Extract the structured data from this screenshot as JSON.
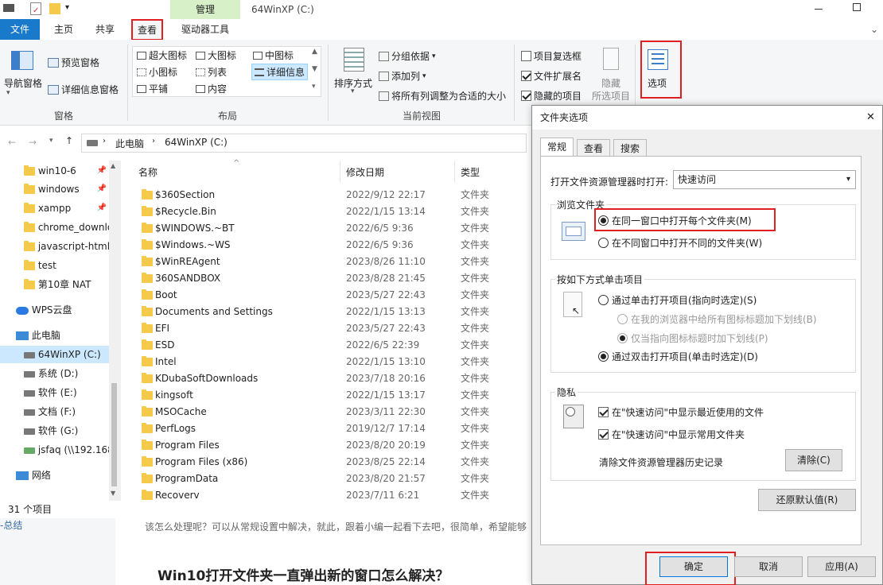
{
  "titlebar": {
    "manage_tab": "管理",
    "title": "64WinXP  (C:)"
  },
  "ribbon_tabs": {
    "file": "文件",
    "home": "主页",
    "share": "共享",
    "view": "查看",
    "drive_tools": "驱动器工具"
  },
  "ribbon": {
    "pane": {
      "nav_pane": "导航窗格",
      "preview_pane": "预览窗格",
      "details_pane": "详细信息窗格",
      "label": "窗格"
    },
    "layout": {
      "xl_icons": "超大图标",
      "large_icons": "大图标",
      "medium_icons": "中图标",
      "small_icons": "小图标",
      "list": "列表",
      "details": "详细信息",
      "tiles": "平铺",
      "content": "内容",
      "label": "布局"
    },
    "current_view": {
      "sort_by": "排序方式",
      "group_by": "分组依据",
      "add_columns": "添加列",
      "fit_columns": "将所有列调整为合适的大小",
      "label": "当前视图"
    },
    "show_hide": {
      "item_checkboxes": "项目复选框",
      "file_ext": "文件扩展名",
      "hidden_items": "隐藏的项目",
      "hide": "隐藏",
      "hide_sub": "所选项目",
      "item_checkboxes_checked": false,
      "file_ext_checked": true,
      "hidden_items_checked": true
    },
    "options": "选项"
  },
  "address": {
    "this_pc": "此电脑",
    "drive": "64WinXP  (C:)"
  },
  "nav": {
    "quick": [
      {
        "label": "win10-6"
      },
      {
        "label": "windows"
      },
      {
        "label": "xampp"
      },
      {
        "label": "chrome_downlo"
      },
      {
        "label": "javascript-html"
      },
      {
        "label": "test"
      },
      {
        "label": "第10章 NAT"
      }
    ],
    "wps": "WPS云盘",
    "this_pc": "此电脑",
    "drives": [
      {
        "label": "64WinXP  (C:)"
      },
      {
        "label": "系统 (D:)"
      },
      {
        "label": "软件 (E:)"
      },
      {
        "label": "文档 (F:)"
      },
      {
        "label": "软件 (G:)"
      },
      {
        "label": "jsfaq (\\\\192.168"
      }
    ],
    "network": "网络"
  },
  "columns": {
    "name": "名称",
    "date": "修改日期",
    "type": "类型"
  },
  "files": [
    {
      "name": "$360Section",
      "date": "2022/9/12 22:17",
      "type": "文件夹"
    },
    {
      "name": "$Recycle.Bin",
      "date": "2022/1/15 13:14",
      "type": "文件夹"
    },
    {
      "name": "$WINDOWS.~BT",
      "date": "2022/6/5 9:36",
      "type": "文件夹"
    },
    {
      "name": "$Windows.~WS",
      "date": "2022/6/5 9:36",
      "type": "文件夹"
    },
    {
      "name": "$WinREAgent",
      "date": "2023/8/26 11:10",
      "type": "文件夹"
    },
    {
      "name": "360SANDBOX",
      "date": "2023/8/28 21:45",
      "type": "文件夹"
    },
    {
      "name": "Boot",
      "date": "2023/5/27 22:43",
      "type": "文件夹"
    },
    {
      "name": "Documents and Settings",
      "date": "2022/1/15 13:13",
      "type": "文件夹"
    },
    {
      "name": "EFI",
      "date": "2023/5/27 22:43",
      "type": "文件夹"
    },
    {
      "name": "ESD",
      "date": "2022/6/5 22:39",
      "type": "文件夹"
    },
    {
      "name": "Intel",
      "date": "2022/1/15 13:10",
      "type": "文件夹"
    },
    {
      "name": "KDubaSoftDownloads",
      "date": "2023/7/18 20:16",
      "type": "文件夹"
    },
    {
      "name": "kingsoft",
      "date": "2022/1/15 13:17",
      "type": "文件夹"
    },
    {
      "name": "MSOCache",
      "date": "2023/3/11 22:30",
      "type": "文件夹"
    },
    {
      "name": "PerfLogs",
      "date": "2019/12/7 17:14",
      "type": "文件夹"
    },
    {
      "name": "Program Files",
      "date": "2023/8/20 20:19",
      "type": "文件夹"
    },
    {
      "name": "Program Files (x86)",
      "date": "2023/8/25 22:14",
      "type": "文件夹"
    },
    {
      "name": "ProgramData",
      "date": "2023/8/20 21:57",
      "type": "文件夹"
    },
    {
      "name": "Recoverv",
      "date": "2023/7/11 6:21",
      "type": "文件夹"
    }
  ],
  "status": "31 个项目",
  "web": {
    "sidebar_text": "-总结",
    "paragraph": "该怎么处理呢？可以从常规设置中解决，就此，跟着小编一起看下去吧，很简单，希望能够",
    "heading": "Win10打开文件夹一直弹出新的窗口怎么解决？"
  },
  "dialog": {
    "title": "文件夹选项",
    "close": "✕",
    "tabs": {
      "general": "常规",
      "view": "查看",
      "search": "搜索"
    },
    "open_label": "打开文件资源管理器时打开:",
    "open_value": "快速访问",
    "browse_title": "浏览文件夹",
    "browse_same": "在同一窗口中打开每个文件夹(M)",
    "browse_new": "在不同窗口中打开不同的文件夹(W)",
    "click_title": "按如下方式单击项目",
    "single_click": "通过单击打开项目(指向时选定)(S)",
    "underline_browser": "在我的浏览器中给所有图标标题加下划线(B)",
    "underline_hover": "仅当指向图标标题时加下划线(P)",
    "double_click": "通过双击打开项目(单击时选定)(D)",
    "privacy_title": "隐私",
    "recent_files": "在\"快速访问\"中显示最近使用的文件",
    "frequent_folders": "在\"快速访问\"中显示常用文件夹",
    "clear_label": "清除文件资源管理器历史记录",
    "clear_btn": "清除(C)",
    "restore_btn": "还原默认值(R)",
    "ok": "确定",
    "cancel": "取消",
    "apply": "应用(A)"
  }
}
